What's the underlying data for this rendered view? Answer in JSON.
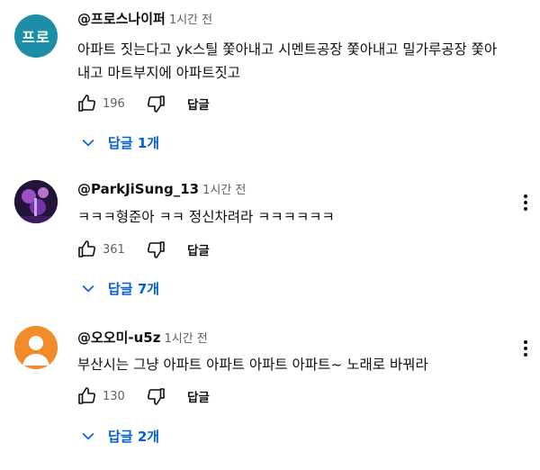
{
  "comments": [
    {
      "avatar_text": "프로",
      "avatar_color": "#1b8fa8",
      "author": "@프로스나이퍼",
      "time": "1시간 전",
      "text": "아파트 짓는다고 yk스틸 쫓아내고 시멘트공장 쫓아내고 밀가루공장 쫓아내고 마트부지에 아파트짓고",
      "likes": "196",
      "reply_label": "답글",
      "replies_label": "답글 1개"
    },
    {
      "avatar_text": "",
      "avatar_color": "#2a1846",
      "author": "@ParkJiSung_13",
      "time": "1시간 전",
      "text": "ㅋㅋㅋ형준아 ㅋㅋ 정신차려라 ㅋㅋㅋㅋㅋㅋ",
      "likes": "361",
      "reply_label": "답글",
      "replies_label": "답글 7개"
    },
    {
      "avatar_text": "",
      "avatar_color": "#f28b2c",
      "author": "@오오미-u5z",
      "time": "1시간 전",
      "text": "부산시는 그냥 아파트 아파트 아파트 아파트~ 노래로 바꿔라",
      "likes": "130",
      "reply_label": "답글",
      "replies_label": "답글 2개"
    }
  ],
  "icons": {
    "like": "thumbs-up-icon",
    "dislike": "thumbs-down-icon",
    "menu": "more-vert-icon",
    "expand": "chevron-down-icon"
  },
  "colors": {
    "link": "#065fd4",
    "secondary": "#606060"
  }
}
